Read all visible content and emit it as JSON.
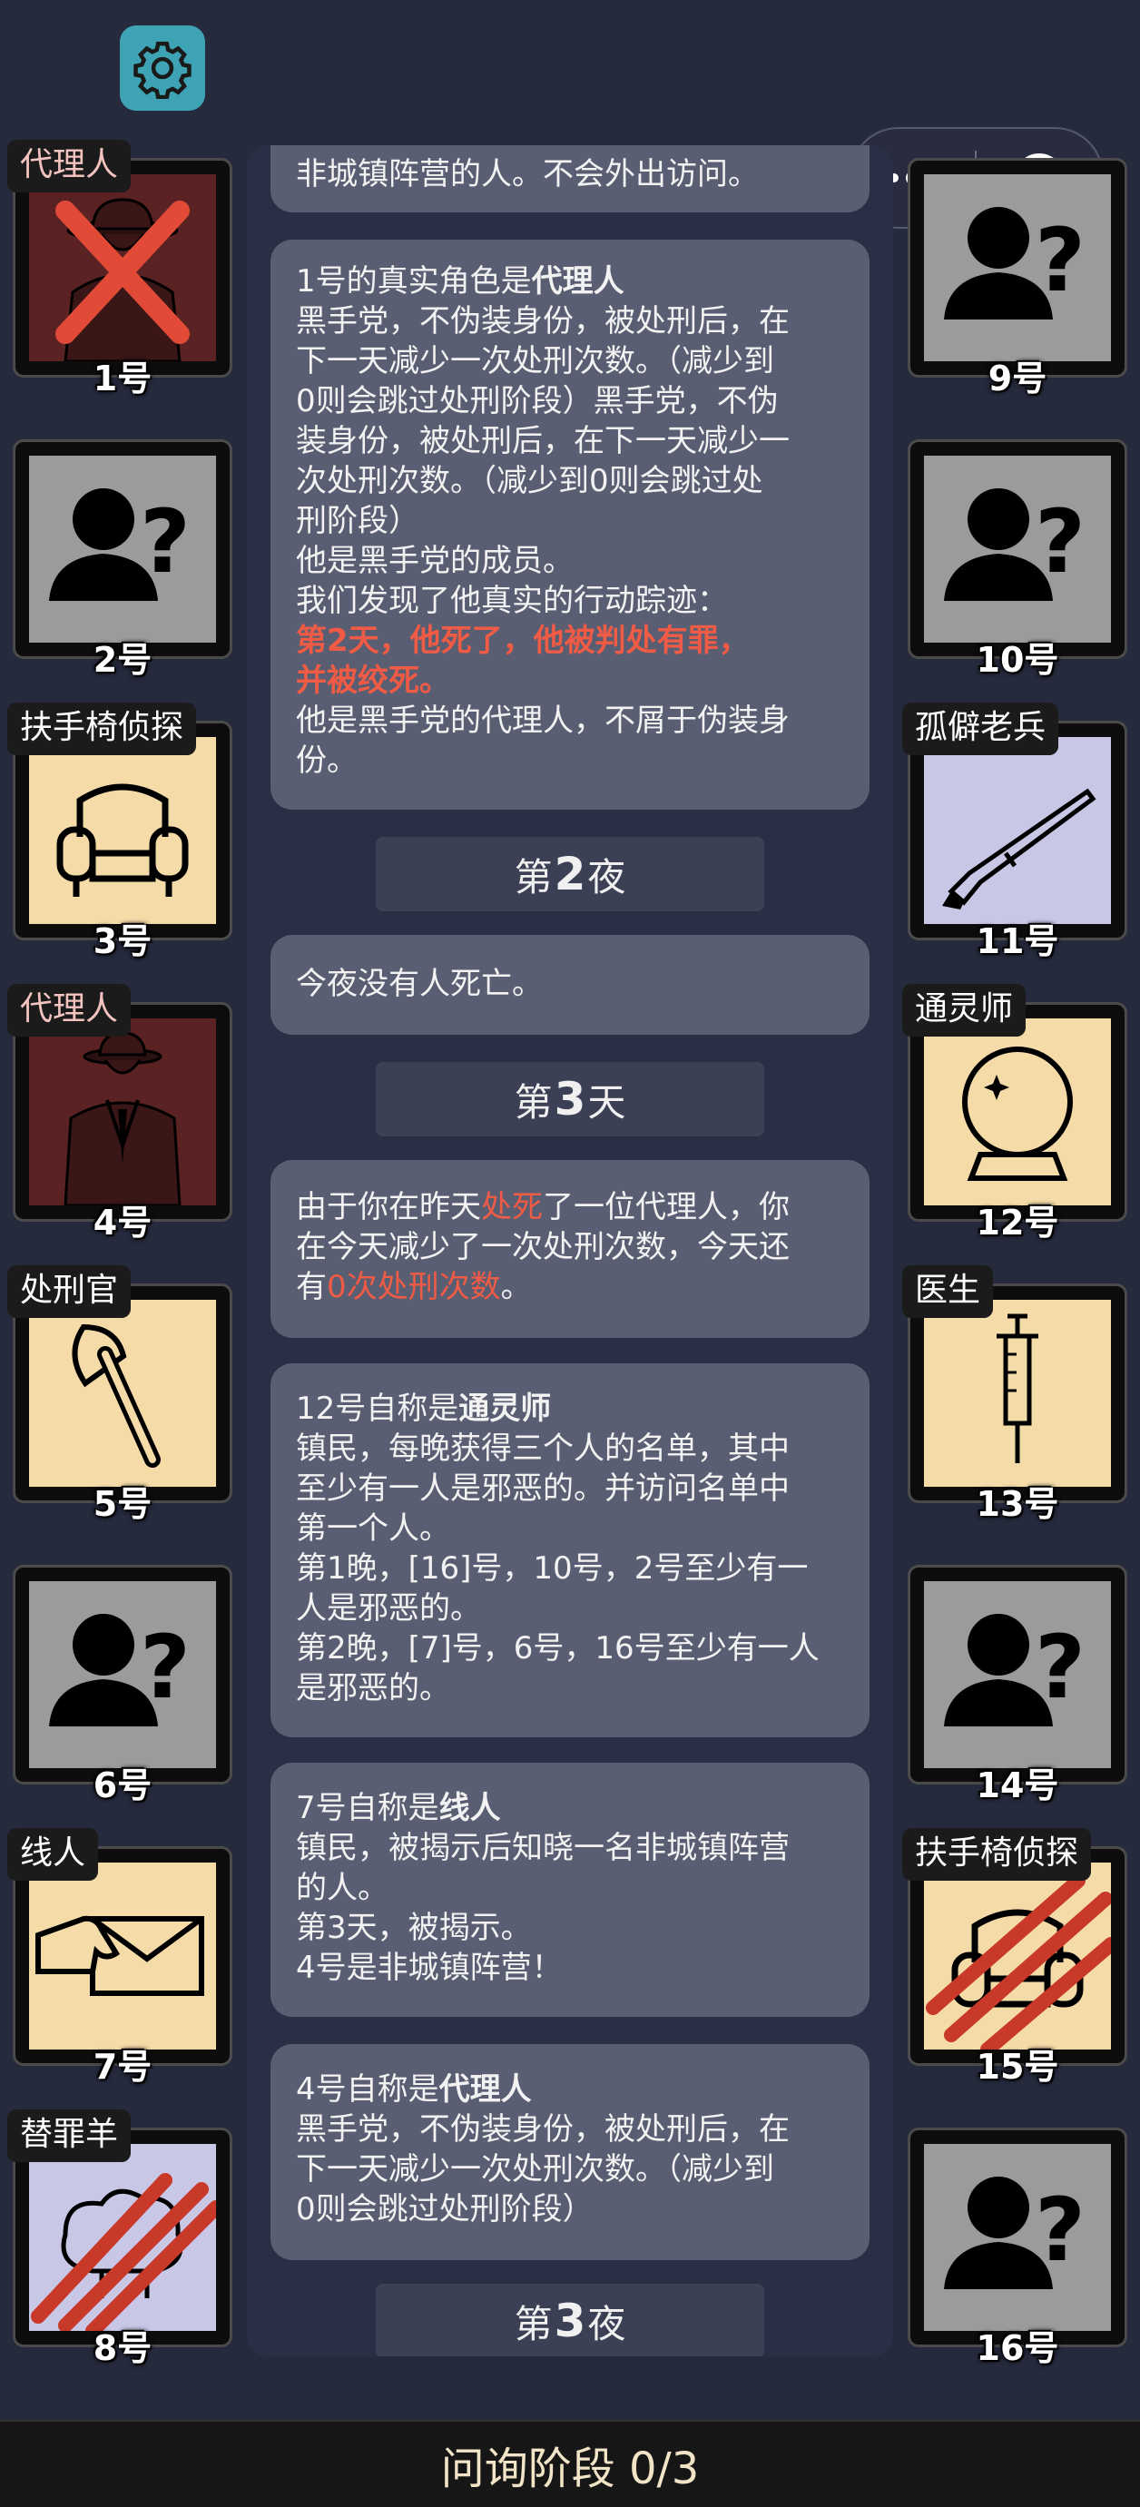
{
  "top": {
    "settings_icon": "gear-icon",
    "menu_icon": "more-dots-icon",
    "close_icon": "target-close-icon"
  },
  "log": {
    "m0": {
      "line": "非城镇阵营的人。不会外出访问。"
    },
    "m1": {
      "l1_prefix": "1号的真实角色是",
      "l1_role": "代理人",
      "l2": "黑手党，不伪装身份，被处刑后，在",
      "l3": "下一天减少一次处刑次数。（减少到",
      "l4": "0则会跳过处刑阶段）黑手党，不伪",
      "l5": "装身份，被处刑后，在下一天减少一",
      "l6": "次处刑次数。（减少到0则会跳过处",
      "l7": "刑阶段）",
      "l8": "他是黑手党的成员。",
      "l9": "我们发现了他真实的行动踪迹：",
      "l10": "第2天，他死了，他被判处有罪，",
      "l11": "并被绞死。",
      "l12": "他是黑手党的代理人，不屑于伪装身",
      "l13": "份。"
    },
    "night2": {
      "prefix": "第",
      "num": "2",
      "suffix": "夜"
    },
    "m2": {
      "line": "今夜没有人死亡。"
    },
    "day3": {
      "prefix": "第",
      "num": "3",
      "suffix": "天"
    },
    "m3": {
      "a": "由于你在昨天",
      "b": "处死",
      "c": "了一位代理人，你",
      "l2": "在今天减少了一次处刑次数，今天还",
      "d": "有",
      "e": "0次处刑次数",
      "f": "。"
    },
    "m4": {
      "l1_prefix": "12号自称是",
      "l1_role": "通灵师",
      "l2": "镇民，每晚获得三个人的名单，其中",
      "l3": "至少有一人是邪恶的。并访问名单中",
      "l4": "第一个人。",
      "l5": "第1晚，[16]号，10号，2号至少有一",
      "l6": "人是邪恶的。",
      "l7": "第2晚，[7]号，6号，16号至少有一人",
      "l8": "是邪恶的。"
    },
    "m5": {
      "l1_prefix": "7号自称是",
      "l1_role": "线人",
      "l2": "镇民，被揭示后知晓一名非城镇阵营",
      "l3": "的人。",
      "l4": "第3天，被揭示。",
      "l5": "4号是非城镇阵营！"
    },
    "m6": {
      "l1_prefix": "4号自称是",
      "l1_role": "代理人",
      "l2": "黑手党，不伪装身份，被处刑后，在",
      "l3": "下一天减少一次处刑次数。（减少到",
      "l4": "0则会跳过处刑阶段）"
    },
    "night3": {
      "prefix": "第",
      "num": "3",
      "suffix": "夜"
    }
  },
  "players": [
    {
      "num": "1号",
      "tag": "代理人",
      "icon": "agent-fedora-icon",
      "bg": "maroon",
      "status": "executed-x"
    },
    {
      "num": "2号",
      "tag": "",
      "icon": "unknown-person-icon",
      "bg": "gray",
      "status": ""
    },
    {
      "num": "3号",
      "tag": "扶手椅侦探",
      "icon": "armchair-icon",
      "bg": "cream",
      "status": ""
    },
    {
      "num": "4号",
      "tag": "代理人",
      "icon": "agent-suit-icon",
      "bg": "maroon",
      "status": ""
    },
    {
      "num": "5号",
      "tag": "处刑官",
      "icon": "axe-icon",
      "bg": "cream",
      "status": ""
    },
    {
      "num": "6号",
      "tag": "",
      "icon": "unknown-person-icon",
      "bg": "gray",
      "status": ""
    },
    {
      "num": "7号",
      "tag": "线人",
      "icon": "envelope-hand-icon",
      "bg": "cream",
      "status": ""
    },
    {
      "num": "8号",
      "tag": "替罪羊",
      "icon": "sheep-icon",
      "bg": "lavender",
      "status": "claw-marks"
    },
    {
      "num": "9号",
      "tag": "",
      "icon": "unknown-person-icon",
      "bg": "gray",
      "status": ""
    },
    {
      "num": "10号",
      "tag": "",
      "icon": "unknown-person-icon",
      "bg": "gray",
      "status": ""
    },
    {
      "num": "11号",
      "tag": "孤僻老兵",
      "icon": "rifle-icon",
      "bg": "lavender",
      "status": ""
    },
    {
      "num": "12号",
      "tag": "通灵师",
      "icon": "crystal-ball-icon",
      "bg": "cream",
      "status": ""
    },
    {
      "num": "13号",
      "tag": "医生",
      "icon": "syringe-icon",
      "bg": "cream",
      "status": ""
    },
    {
      "num": "14号",
      "tag": "",
      "icon": "unknown-person-icon",
      "bg": "gray",
      "status": ""
    },
    {
      "num": "15号",
      "tag": "扶手椅侦探",
      "icon": "armchair-icon",
      "bg": "cream",
      "status": "claw-marks"
    },
    {
      "num": "16号",
      "tag": "",
      "icon": "unknown-person-icon",
      "bg": "gray",
      "status": ""
    }
  ],
  "bottom": {
    "label": "问询阶段 0/3"
  },
  "colors": {
    "background": "#262a3d",
    "panel": "#2b2f45",
    "message": "#5a5e73",
    "highlight": "#ef5b44",
    "settings": "#3fa3b6"
  }
}
